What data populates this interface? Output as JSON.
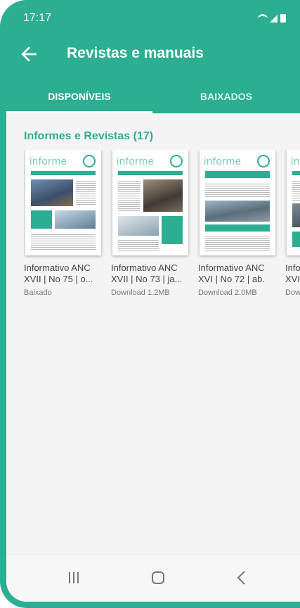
{
  "status_bar": {
    "time": "17:17"
  },
  "app_bar": {
    "title": "Revistas e manuais"
  },
  "tabs": [
    {
      "label": "DISPONÍVEIS",
      "active": true
    },
    {
      "label": "BAIXADOS",
      "active": false
    }
  ],
  "section": {
    "title": "Informes e Revistas (17)",
    "items": [
      {
        "title_line1": "Informativo ANC",
        "title_line2": "XVII | No 75 | o...",
        "status": "Baixado",
        "cover_brand": "informe"
      },
      {
        "title_line1": "Informativo ANC",
        "title_line2": "XVII | No 73 | ja...",
        "status": "Download 1.2MB",
        "cover_brand": "informe"
      },
      {
        "title_line1": "Informativo ANC",
        "title_line2": "XVI | No 72 | ab.",
        "status": "Download 2.0MB",
        "cover_brand": "informe"
      },
      {
        "title_line1": "Info",
        "title_line2": "XVI",
        "status": "Dow",
        "cover_brand": "inf"
      }
    ]
  },
  "colors": {
    "accent": "#2bae91",
    "background": "#f4f4f4"
  }
}
